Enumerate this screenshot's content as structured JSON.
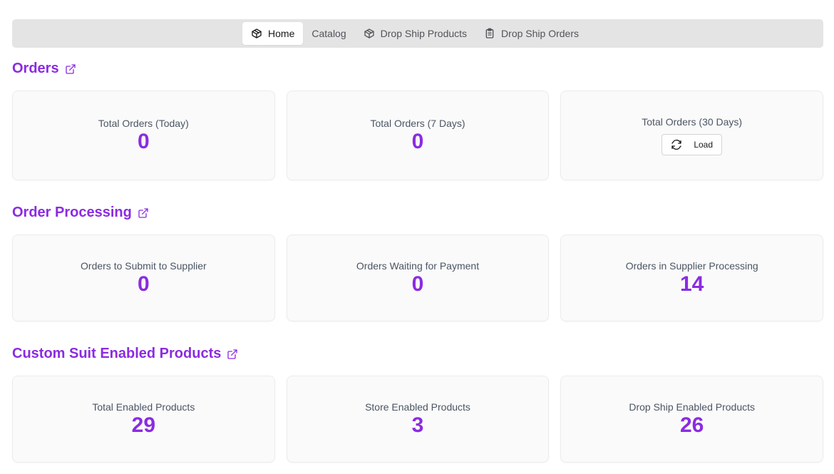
{
  "nav": {
    "tabs": [
      {
        "label": "Home",
        "icon": "package-icon",
        "active": true
      },
      {
        "label": "Catalog",
        "icon": "",
        "active": false
      },
      {
        "label": "Drop Ship Products",
        "icon": "package-icon",
        "active": false
      },
      {
        "label": "Drop Ship Orders",
        "icon": "clipboard-icon",
        "active": false
      }
    ]
  },
  "colors": {
    "accent": "#8b2be2",
    "card_bg": "#fafafa",
    "navbar_bg": "#e4e4e4"
  },
  "sections": {
    "orders": {
      "title": "Orders",
      "cards": [
        {
          "label": "Total Orders (Today)",
          "value": "0"
        },
        {
          "label": "Total Orders (7 Days)",
          "value": "0"
        },
        {
          "label": "Total Orders (30 Days)",
          "button_label": "Load",
          "button_icon": "refresh-icon"
        }
      ]
    },
    "order_processing": {
      "title": "Order Processing",
      "cards": [
        {
          "label": "Orders to Submit to Supplier",
          "value": "0"
        },
        {
          "label": "Orders Waiting for Payment",
          "value": "0"
        },
        {
          "label": "Orders in Supplier Processing",
          "value": "14"
        }
      ]
    },
    "custom_suit": {
      "title": "Custom Suit Enabled Products",
      "cards": [
        {
          "label": "Total Enabled Products",
          "value": "29"
        },
        {
          "label": "Store Enabled Products",
          "value": "3"
        },
        {
          "label": "Drop Ship Enabled Products",
          "value": "26"
        }
      ]
    }
  }
}
